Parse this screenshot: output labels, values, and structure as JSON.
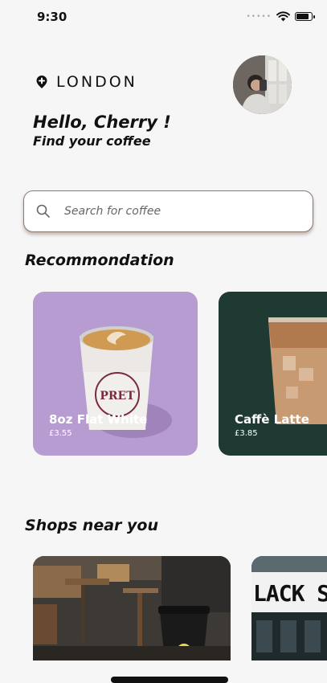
{
  "status_bar": {
    "time": "9:30"
  },
  "location": {
    "city": "LONDON",
    "icon": "location-pin-icon"
  },
  "greeting": {
    "title": "Hello, Cherry !",
    "subtitle": "Find your coffee"
  },
  "search": {
    "placeholder": "Search for coffee",
    "value": "",
    "icon": "search-icon"
  },
  "recommendation": {
    "title": "Recommondation",
    "items": [
      {
        "name": "8oz Flat White",
        "price": "£3.55",
        "background": "#b79cd2"
      },
      {
        "name": "Caffè Latte",
        "price": "£3.85",
        "background": "#1f3a33"
      }
    ]
  },
  "shops": {
    "title": "Shops near you",
    "items": [
      {
        "sign_text": "",
        "background": "#3d3a36"
      },
      {
        "sign_text": "LACK S",
        "background": "#2d3b3e"
      }
    ]
  },
  "colors": {
    "background": "#f7f6f6",
    "search_border": "#8a7a70"
  }
}
